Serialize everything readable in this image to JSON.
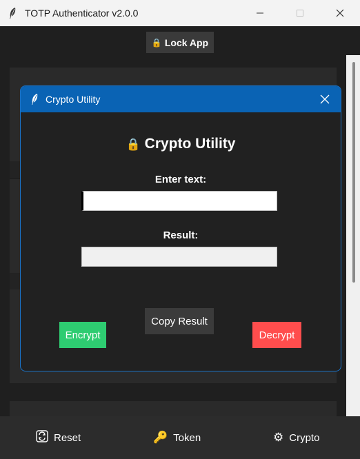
{
  "window": {
    "title": "TOTP Authenticator v2.0.0",
    "icons": [
      "feather-icon",
      "minimize-icon",
      "maximize-icon",
      "close-icon"
    ]
  },
  "header": {
    "lock_label": "Lock App",
    "lock_icon": "lock-icon"
  },
  "dialog": {
    "title": "Crypto Utility",
    "heading": "Crypto Utility",
    "input_label": "Enter text:",
    "input_value": "",
    "result_label": "Result:",
    "result_value": "",
    "buttons": {
      "encrypt": "Encrypt",
      "copy": "Copy Result",
      "decrypt": "Decrypt"
    },
    "colors": {
      "titlebar": "#0a63b4",
      "encrypt": "#2ecc71",
      "decrypt": "#ff4d4d"
    }
  },
  "bottom_nav": {
    "reset": "Reset",
    "token": "Token",
    "crypto": "Crypto"
  }
}
